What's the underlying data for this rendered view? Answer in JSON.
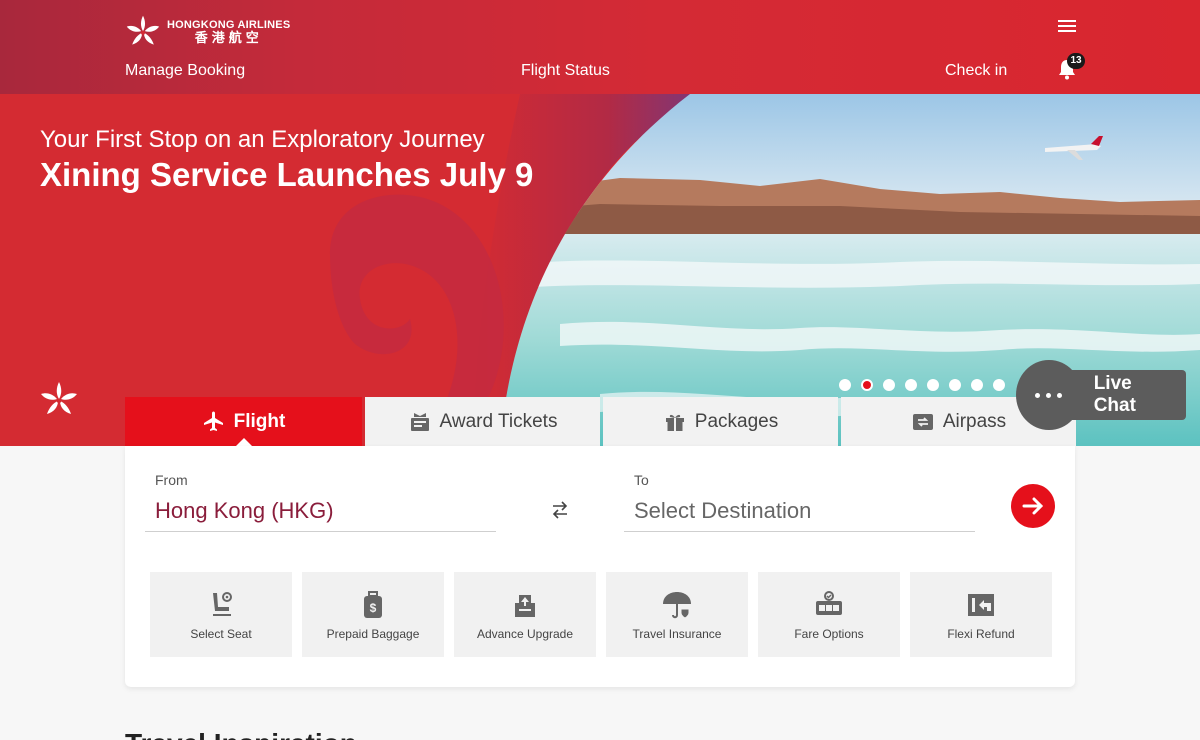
{
  "header": {
    "logo_en": "HONGKONG AIRLINES",
    "logo_zh": "香港航空",
    "nav": [
      "Manage Booking",
      "Flight Status",
      "Check in"
    ],
    "notification_count": "13"
  },
  "hero": {
    "subtitle": "Your First Stop on an Exploratory Journey",
    "title": "Xining Service Launches July 9",
    "slides_total": 8,
    "slide_active": 2
  },
  "chat": {
    "label": "Live Chat"
  },
  "tabs": [
    {
      "label": "Flight",
      "icon": "plane-icon",
      "active": true
    },
    {
      "label": "Award Tickets",
      "icon": "award-ticket-icon",
      "active": false
    },
    {
      "label": "Packages",
      "icon": "gift-icon",
      "active": false
    },
    {
      "label": "Airpass",
      "icon": "airpass-icon",
      "active": false
    }
  ],
  "booking": {
    "from_label": "From",
    "from_value": "Hong Kong (HKG)",
    "to_label": "To",
    "to_value": "Select Destination"
  },
  "services": [
    {
      "label": "Select Seat",
      "icon": "seat-icon"
    },
    {
      "label": "Prepaid Baggage",
      "icon": "baggage-icon"
    },
    {
      "label": "Advance Upgrade",
      "icon": "upgrade-icon"
    },
    {
      "label": "Travel Insurance",
      "icon": "umbrella-icon"
    },
    {
      "label": "Fare Options",
      "icon": "fare-options-icon"
    },
    {
      "label": "Flexi Refund",
      "icon": "refund-icon"
    }
  ],
  "section": {
    "title": "Travel Inspiration"
  },
  "colors": {
    "brand_red": "#e5101b",
    "header_red": "#d9262f",
    "accent_burgundy": "#8a1d3b"
  }
}
